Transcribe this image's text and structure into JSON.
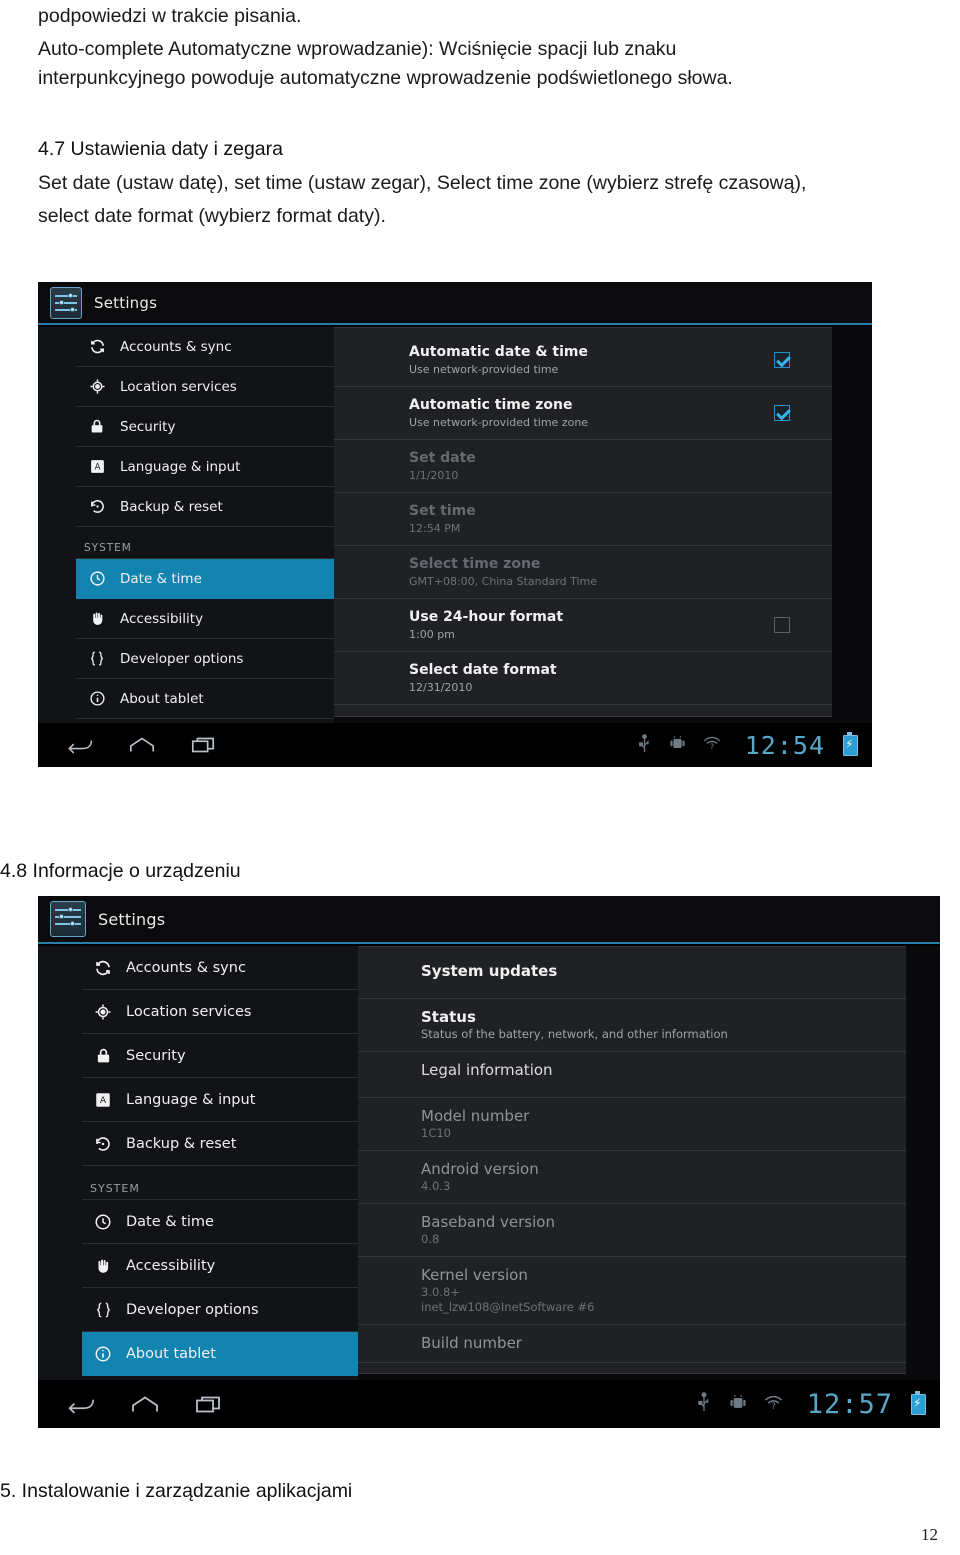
{
  "document": {
    "paragraph1_line1": "podpowiedzi w trakcie pisania.",
    "paragraph1_line2": "Auto-complete Automatyczne wprowadzanie): Wciśnięcie spacji lub znaku",
    "paragraph1_line3": "interpunkcyjnego powoduje automatyczne wprowadzenie podświetlonego słowa.",
    "heading_4_7": "4.7 Ustawienia daty i zegara",
    "paragraph2_line1": "Set date (ustaw datę), set time (ustaw zegar), Select time zone (wybierz strefę czasową),",
    "paragraph2_line2": "select date format (wybierz format daty).",
    "heading_4_8": "4.8 Informacje o urządzeniu",
    "heading_5": "5.    Instalowanie i zarządzanie aplikacjami",
    "page_number": "12"
  },
  "screenshot_datetime": {
    "app_title": "Settings",
    "nav": {
      "items": [
        {
          "label": "Accounts & sync",
          "icon": "sync-icon",
          "selected": false
        },
        {
          "label": "Location services",
          "icon": "location-icon",
          "selected": false
        },
        {
          "label": "Security",
          "icon": "lock-icon",
          "selected": false
        },
        {
          "label": "Language & input",
          "icon": "language-icon",
          "selected": false
        },
        {
          "label": "Backup & reset",
          "icon": "backup-reset-icon",
          "selected": false
        }
      ],
      "section_label": "SYSTEM",
      "system_items": [
        {
          "label": "Date & time",
          "icon": "clock-icon",
          "selected": true
        },
        {
          "label": "Accessibility",
          "icon": "hand-icon",
          "selected": false
        },
        {
          "label": "Developer options",
          "icon": "braces-icon",
          "selected": false
        },
        {
          "label": "About tablet",
          "icon": "info-icon",
          "selected": false
        }
      ]
    },
    "prefs": [
      {
        "title": "Automatic date & time",
        "summary": "Use network-provided time",
        "checkbox": "checked",
        "dim": false
      },
      {
        "title": "Automatic time zone",
        "summary": "Use network-provided time zone",
        "checkbox": "checked",
        "dim": false
      },
      {
        "title": "Set date",
        "summary": "1/1/2010",
        "checkbox": "none",
        "dim": true
      },
      {
        "title": "Set time",
        "summary": "12:54 PM",
        "checkbox": "none",
        "dim": true
      },
      {
        "title": "Select time zone",
        "summary": "GMT+08:00, China Standard Time",
        "checkbox": "none",
        "dim": true
      },
      {
        "title": "Use 24-hour format",
        "summary": "1:00 pm",
        "checkbox": "unchecked",
        "dim": false
      },
      {
        "title": "Select date format",
        "summary": "12/31/2010",
        "checkbox": "none",
        "dim": false
      }
    ],
    "statusbar": {
      "back": "back-icon",
      "home": "home-icon",
      "recents": "recents-icon",
      "usb": "usb-icon",
      "android_debug": "android-debug-icon",
      "wifi_unknown": "wifi-question-icon",
      "clock": "12:54",
      "battery": "battery-charging-icon"
    }
  },
  "screenshot_about": {
    "app_title": "Settings",
    "nav": {
      "items": [
        {
          "label": "Accounts & sync",
          "icon": "sync-icon",
          "selected": false
        },
        {
          "label": "Location services",
          "icon": "location-icon",
          "selected": false
        },
        {
          "label": "Security",
          "icon": "lock-icon",
          "selected": false
        },
        {
          "label": "Language & input",
          "icon": "language-icon",
          "selected": false
        },
        {
          "label": "Backup & reset",
          "icon": "backup-reset-icon",
          "selected": false
        }
      ],
      "section_label": "SYSTEM",
      "system_items": [
        {
          "label": "Date & time",
          "icon": "clock-icon",
          "selected": false
        },
        {
          "label": "Accessibility",
          "icon": "hand-icon",
          "selected": false
        },
        {
          "label": "Developer options",
          "icon": "braces-icon",
          "selected": false
        },
        {
          "label": "About tablet",
          "icon": "info-icon",
          "selected": true
        }
      ]
    },
    "prefs": [
      {
        "title": "System updates",
        "summary": "",
        "dim": false,
        "bold": true
      },
      {
        "title": "Status",
        "summary": "Status of the battery, network, and other information",
        "dim": false,
        "bold": true
      },
      {
        "title": "Legal information",
        "summary": "",
        "dim": false,
        "bold": false
      },
      {
        "title": "Model number",
        "summary": "1C10",
        "dim": true,
        "bold": false
      },
      {
        "title": "Android version",
        "summary": "4.0.3",
        "dim": true,
        "bold": false
      },
      {
        "title": "Baseband version",
        "summary": "0.8",
        "dim": true,
        "bold": false
      },
      {
        "title": "Kernel version",
        "summary": "3.0.8+\ninet_lzw108@InetSoftware #6",
        "dim": true,
        "bold": false
      },
      {
        "title": "Build number",
        "summary": "",
        "dim": true,
        "bold": false
      }
    ],
    "statusbar": {
      "back": "back-icon",
      "home": "home-icon",
      "recents": "recents-icon",
      "usb": "usb-icon",
      "android_debug": "android-debug-icon",
      "wifi_unknown": "wifi-question-icon",
      "clock": "12:57",
      "battery": "battery-charging-icon"
    }
  },
  "colors": {
    "accent": "#1383b0",
    "clock": "#57a7c9",
    "panel": "#1f2124",
    "nav": "#121316"
  }
}
